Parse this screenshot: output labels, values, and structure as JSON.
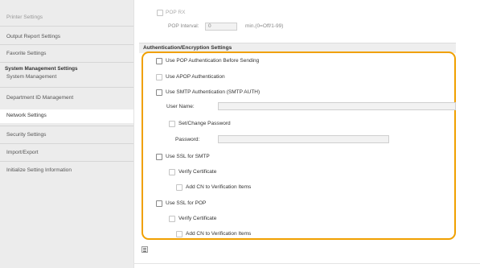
{
  "sidebar": {
    "items": [
      {
        "label": "Printer Settings"
      },
      {
        "label": "Output Report Settings"
      },
      {
        "label": "Favorite Settings"
      }
    ],
    "section_header": "System Management Settings",
    "section_items": [
      {
        "label": "System Management"
      },
      {
        "label": "Department ID Management"
      },
      {
        "label": "Network Settings"
      },
      {
        "label": "Security Settings"
      },
      {
        "label": "Import/Export"
      },
      {
        "label": "Initialize Setting Information"
      }
    ]
  },
  "pop_rx": {
    "label": "POP RX",
    "interval_label": "POP Interval:",
    "interval_value": "0",
    "interval_unit": "min.(0=Off/1-99)"
  },
  "auth": {
    "title": "Authentication/Encryption Settings",
    "use_pop_auth": "Use POP Authentication Before Sending",
    "use_apop": "Use APOP Authentication",
    "use_smtp_auth": "Use SMTP Authentication (SMTP AUTH)",
    "user_name_label": "User Name:",
    "user_name_value": "",
    "set_change_password": "Set/Change Password",
    "password_label": "Password:",
    "password_value": "",
    "use_ssl_smtp": "Use SSL for SMTP",
    "verify_cert_smtp": "Verify Certificate",
    "add_cn_smtp": "Add CN to Verification Items",
    "use_ssl_pop": "Use SSL for POP",
    "verify_cert_pop": "Verify Certificate",
    "add_cn_pop": "Add CN to Verification Items"
  },
  "colors": {
    "highlight": "#f0a000",
    "sidebar_bg": "#ececec",
    "active_item_bg": "#ffffff"
  }
}
